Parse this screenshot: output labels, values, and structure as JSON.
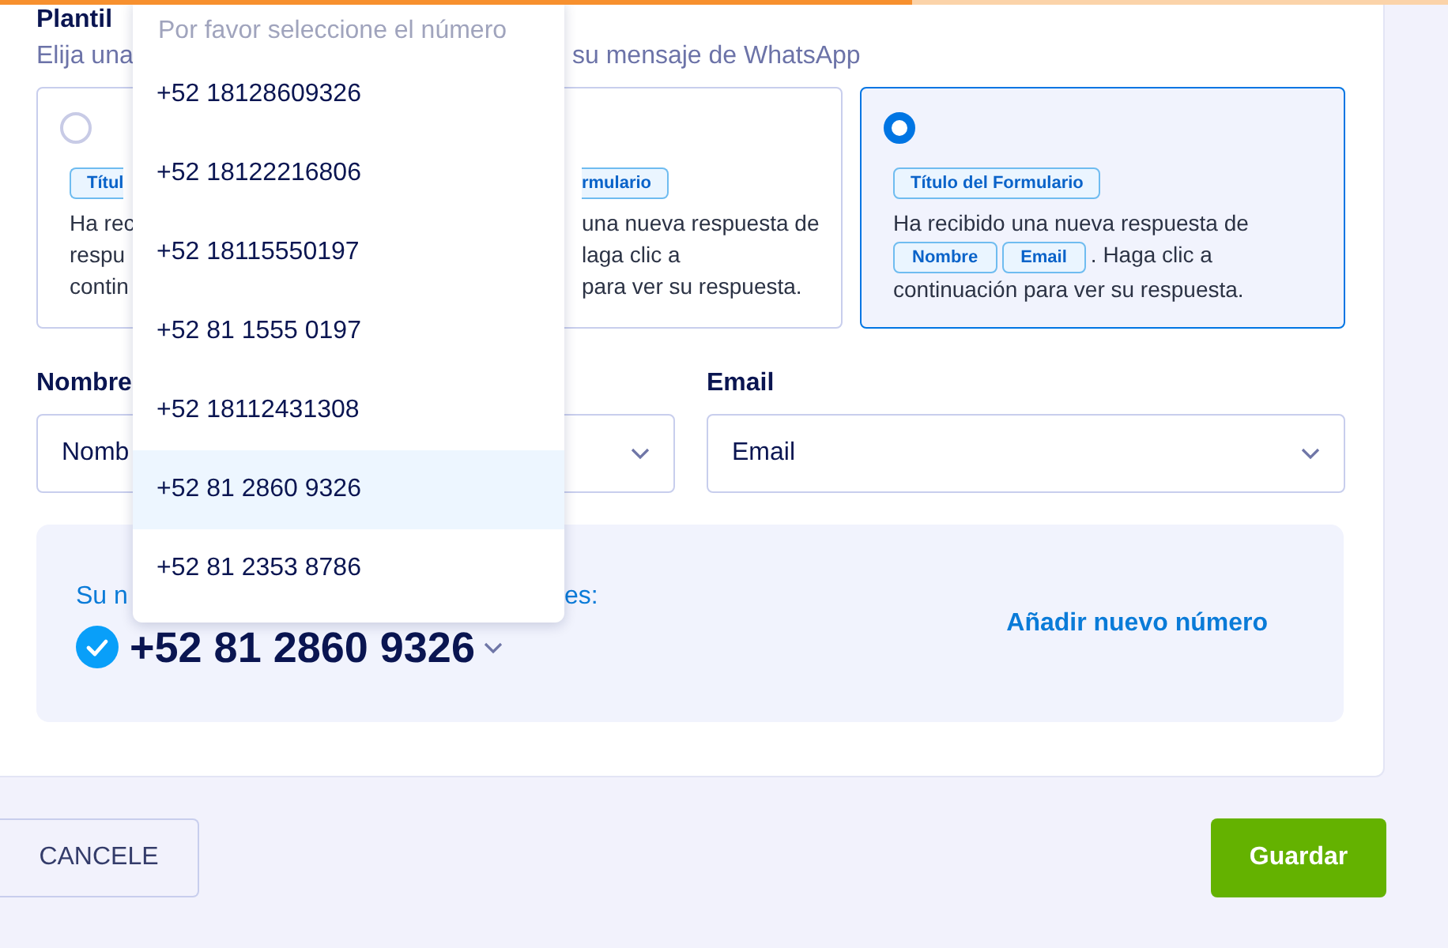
{
  "progress": {
    "level": 0.63
  },
  "header": {
    "title": "Plantil",
    "subtitle_left": "Elija una",
    "subtitle_right": "su mensaje de WhatsApp"
  },
  "templates": [
    {
      "selected": false,
      "tag": "Títul",
      "lines": [
        "Ha rec",
        "respu",
        "contin"
      ],
      "kind": "cut_right"
    },
    {
      "selected": false,
      "tag": "rmulario",
      "lines": [
        "una nueva respuesta de",
        "laga clic a",
        "para ver su respuesta."
      ],
      "kind": "cut_left"
    },
    {
      "selected": true,
      "tag": "Título del Formulario",
      "message": [
        {
          "kind": "text",
          "text": "Ha recibido una nueva respuesta de"
        },
        {
          "kind": "tag",
          "text": "Nombre"
        },
        {
          "kind": "tag",
          "text": "Email"
        },
        {
          "kind": "text",
          "text": ". Haga clic a"
        },
        {
          "kind": "line",
          "text": "continuación para ver su respuesta."
        }
      ]
    }
  ],
  "fields": [
    {
      "label": "Nombre",
      "value": "Nomb"
    },
    {
      "label": "Email",
      "value": "Email"
    }
  ],
  "number_box": {
    "label_left": "Su n",
    "label_right": "es:",
    "number": "+52 81 2860 9326",
    "verified": true,
    "link": "Añadir nuevo número"
  },
  "dropdown": {
    "placeholder": "Por favor seleccione el número",
    "options": [
      {
        "label": "+52 18128609326",
        "selected": false
      },
      {
        "label": "+52 18122216806",
        "selected": false
      },
      {
        "label": "+52 18115550197",
        "selected": false
      },
      {
        "label": "+52 81 1555 0197",
        "selected": false
      },
      {
        "label": "+52 18112431308",
        "selected": false
      },
      {
        "label": "+52 81 2860 9326",
        "selected": true
      },
      {
        "label": "+52 81 2353 8786",
        "selected": false
      }
    ]
  },
  "buttons": {
    "cancel": "CANCELE",
    "save": "Guardar"
  }
}
